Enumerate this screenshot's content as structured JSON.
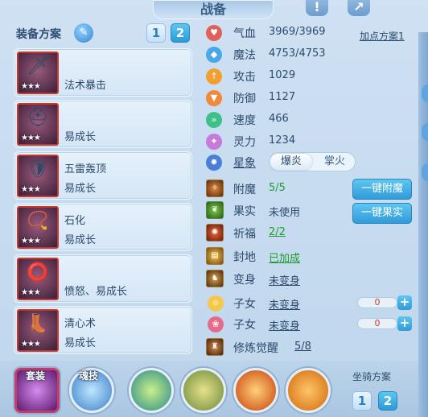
{
  "window": {
    "title": "战备"
  },
  "colors": {
    "accent": "#2f9bd9",
    "equip_border": "#c73a2b",
    "green": "#1f9a2f",
    "counter_red": "#c63a3a"
  },
  "left": {
    "header": "装备方案",
    "tabs": [
      "1",
      "2"
    ],
    "slots": [
      {
        "line1": "",
        "line2": "法术暴击",
        "stars": "★★★",
        "icon": "weapon-icon"
      },
      {
        "line1": "",
        "line2": "易成长",
        "stars": "★★★",
        "icon": "helmet-icon"
      },
      {
        "line1": "五雷轰顶",
        "line2": "易成长",
        "stars": "★★★",
        "icon": "armor-icon"
      },
      {
        "line1": "石化",
        "line2": "易成长",
        "stars": "★★★",
        "icon": "necklace-icon"
      },
      {
        "line1": "",
        "line2": "愤怒、易成长",
        "stars": "★★★",
        "icon": "belt-icon"
      },
      {
        "line1": "清心术",
        "line2": "易成长",
        "stars": "★★★",
        "icon": "boots-icon"
      }
    ]
  },
  "stats": [
    {
      "label": "气血",
      "value": "3969/3969",
      "icon": "heart-icon",
      "color": "#e0605a"
    },
    {
      "label": "魔法",
      "value": "4753/4753",
      "icon": "diamond-icon",
      "color": "#4aa8e8"
    },
    {
      "label": "攻击",
      "value": "1029",
      "icon": "attack-icon",
      "color": "#f0a030"
    },
    {
      "label": "防御",
      "value": "1127",
      "icon": "shield-icon",
      "color": "#f08a3a"
    },
    {
      "label": "速度",
      "value": "466",
      "icon": "speed-icon",
      "color": "#3ec08a"
    },
    {
      "label": "灵力",
      "value": "1234",
      "icon": "spirit-icon",
      "color": "#c77ad8"
    }
  ],
  "add_point_link": "加点方案1",
  "star_sign": {
    "label": "星象",
    "options": [
      "爆炎",
      "掌火"
    ]
  },
  "extras": {
    "enchant": {
      "label": "附魔",
      "value": "5/5"
    },
    "fruit": {
      "label": "果实",
      "value": "未使用"
    },
    "pray": {
      "label": "祈福",
      "value": "2/2"
    },
    "seal": {
      "label": "封地",
      "value": "已加成"
    },
    "transform": {
      "label": "变身",
      "value": "未变身"
    },
    "child1": {
      "label": "子女",
      "value": "未变身",
      "count": "0"
    },
    "child2": {
      "label": "子女",
      "value": "未变身",
      "count": "0"
    },
    "awaken": {
      "label": "修炼觉醒",
      "value": "5/8"
    }
  },
  "buttons": {
    "one_key_enchant": "一键附魔",
    "one_key_fruit": "一键果实",
    "plus": "+"
  },
  "bottom": {
    "suit_label": "套装",
    "soul_label": "魂技",
    "mount_header": "坐骑方案",
    "mount_tabs": [
      "1",
      "2"
    ]
  },
  "topicons": {
    "help": "!",
    "share": "↗"
  }
}
